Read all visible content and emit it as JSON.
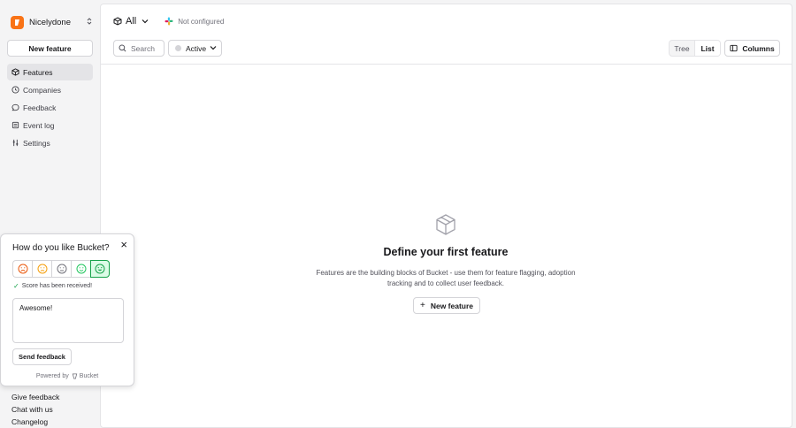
{
  "org": {
    "name": "Nicelydone",
    "brand_color": "#f97316"
  },
  "sidebar": {
    "new_feature_label": "New feature",
    "items": [
      {
        "label": "Features",
        "icon": "box-icon",
        "active": true
      },
      {
        "label": "Companies",
        "icon": "clock-icon",
        "active": false
      },
      {
        "label": "Feedback",
        "icon": "speech-bubble-icon",
        "active": false
      },
      {
        "label": "Event log",
        "icon": "list-icon",
        "active": false
      },
      {
        "label": "Settings",
        "icon": "sliders-icon",
        "active": false
      }
    ],
    "footer_links": [
      "Give feedback",
      "Chat with us",
      "Changelog"
    ]
  },
  "header": {
    "environment": "All",
    "config_status": "Not configured"
  },
  "toolbar": {
    "search_placeholder": "Search",
    "status_filter": "Active",
    "view_tree": "Tree",
    "view_list": "List",
    "selected_view": "List",
    "columns_label": "Columns"
  },
  "empty_state": {
    "title": "Define your first feature",
    "description": "Features are the building blocks of Bucket - use them for feature flagging, adoption tracking and to collect user feedback.",
    "button_label": "New feature"
  },
  "feedback_widget": {
    "question": "How do you like Bucket?",
    "selected_score": 5,
    "received_text": "Score has been received!",
    "comment": "Awesome!",
    "send_label": "Send feedback",
    "powered_by": "Powered by",
    "powered_brand": "Bucket",
    "accent_color": "#16a34a"
  }
}
